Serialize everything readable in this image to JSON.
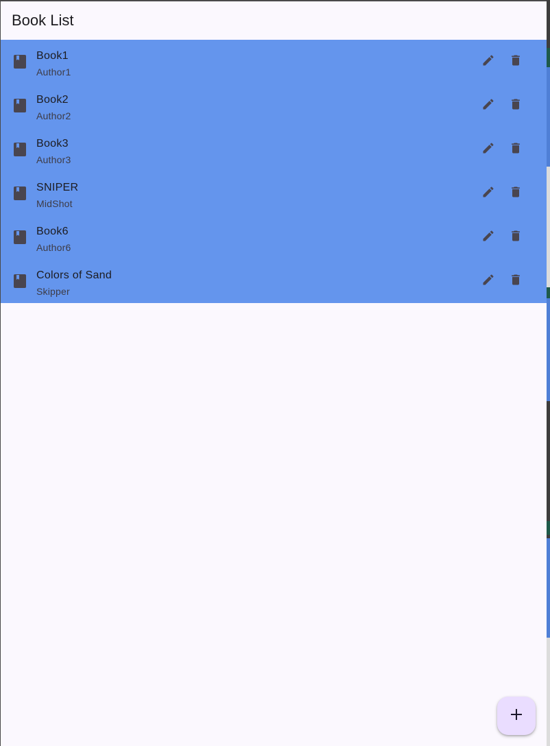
{
  "appbar": {
    "title": "Book List"
  },
  "books": [
    {
      "title": "Book1",
      "author": "Author1"
    },
    {
      "title": "Book2",
      "author": "Author2"
    },
    {
      "title": "Book3",
      "author": "Author3"
    },
    {
      "title": "SNIPER",
      "author": "MidShot"
    },
    {
      "title": "Book6",
      "author": "Author6"
    },
    {
      "title": "Colors of Sand",
      "author": "Skipper"
    }
  ],
  "icons": {
    "leading": "book-icon",
    "edit": "pencil-icon",
    "delete": "trash-icon",
    "fab": "plus-icon"
  },
  "colors": {
    "list_background": "#6495ed",
    "page_background": "#fbf8fe",
    "icon": "#49454f",
    "fab_background": "#eaddff"
  }
}
